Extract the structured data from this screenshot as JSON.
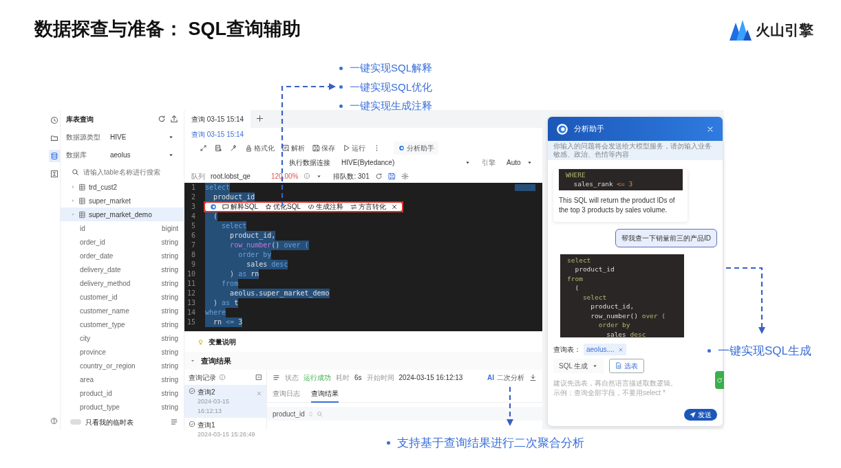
{
  "slide": {
    "title": "数据探查与准备： SQL查询辅助",
    "logo": "火山引擎"
  },
  "callouts": [
    {
      "text": "一键实现SQL解释"
    },
    {
      "text": "一键实现SQL优化"
    },
    {
      "text": "一键实现生成注释"
    }
  ],
  "callout_generate": {
    "text": "一键实现SQL生成"
  },
  "callout_results": {
    "text": "支持基于查询结果进行二次聚合分析"
  },
  "rail": [
    {
      "kind": "history",
      "selected": false
    },
    {
      "kind": "folder",
      "selected": false
    },
    {
      "kind": "database",
      "selected": true
    },
    {
      "kind": "formula",
      "selected": false
    }
  ],
  "sidebar": {
    "title": "库表查询",
    "fields": [
      {
        "label": "数据源类型",
        "value": "HIVE"
      },
      {
        "label": "数据库",
        "value": "aeolus"
      }
    ],
    "search": {
      "placeholder": "请输入table名称进行搜索"
    },
    "tables": [
      {
        "name": "trd_cust2",
        "expanded": false,
        "selected": false
      },
      {
        "name": "super_market",
        "expanded": false,
        "selected": false
      },
      {
        "name": "super_market_demo",
        "expanded": true,
        "selected": true,
        "children": [
          {
            "name": "id",
            "type": "bigint"
          },
          {
            "name": "order_id",
            "type": "string"
          },
          {
            "name": "order_date",
            "type": "string"
          },
          {
            "name": "delivery_date",
            "type": "string"
          },
          {
            "name": "delivery_method",
            "type": "string"
          },
          {
            "name": "customer_id",
            "type": "string"
          },
          {
            "name": "customer_name",
            "type": "string"
          },
          {
            "name": "customer_type",
            "type": "string"
          },
          {
            "name": "city",
            "type": "string"
          },
          {
            "name": "province",
            "type": "string"
          },
          {
            "name": "country_or_region",
            "type": "string"
          },
          {
            "name": "area",
            "type": "string"
          },
          {
            "name": "product_id",
            "type": "string"
          },
          {
            "name": "product_type",
            "type": "string"
          }
        ]
      }
    ],
    "temp_only": {
      "label": "只看我的临时表",
      "on": false
    }
  },
  "editor": {
    "tabs": [
      {
        "label": "查询 03-15 15:14",
        "selected": true
      }
    ],
    "breadcrumb": "查询 03-15 15:14",
    "tools": [
      {
        "kind": "expand"
      },
      {
        "kind": "insert"
      },
      {
        "kind": "wand"
      },
      {
        "kind": "format",
        "label": "格式化"
      },
      {
        "kind": "parse",
        "label": "解析"
      },
      {
        "kind": "save",
        "label": "保存"
      },
      {
        "kind": "run",
        "label": "运行"
      },
      {
        "kind": "more"
      }
    ],
    "assistant_button": "分析助手",
    "connection_label": "执行数据连接",
    "connection": "HIVE(Bytedance)",
    "engine_label": "引擎",
    "engine": "Auto",
    "queue_label": "队列",
    "queue": "root.lobst_qe",
    "usage": "120.00%",
    "queue_count": "排队数: 301",
    "code_selected": true,
    "lines": [
      {
        "n": "1",
        "tokens": [
          {
            "kind": "kw",
            "text": "select"
          }
        ]
      },
      {
        "n": "2",
        "tokens": [
          {
            "kind": "id",
            "text": "  product_id"
          }
        ]
      },
      {
        "n": "3"
      },
      {
        "n": "4",
        "tokens": [
          {
            "kind": "punct",
            "text": "  ("
          }
        ]
      },
      {
        "n": "5",
        "tokens": [
          {
            "kind": "kw",
            "text": "    select"
          }
        ]
      },
      {
        "n": "6",
        "tokens": [
          {
            "kind": "id",
            "text": "      product_id,"
          }
        ]
      },
      {
        "n": "7",
        "tokens": [
          {
            "kind": "fn",
            "text": "      row_number"
          },
          {
            "kind": "punct",
            "text": "() "
          },
          {
            "kind": "kw",
            "text": "over ("
          }
        ]
      },
      {
        "n": "8",
        "tokens": [
          {
            "kind": "kw",
            "text": "        order by"
          }
        ]
      },
      {
        "n": "9",
        "tokens": [
          {
            "kind": "id",
            "text": "          sales "
          },
          {
            "kind": "kw",
            "text": "desc"
          }
        ]
      },
      {
        "n": "10",
        "tokens": [
          {
            "kind": "punct",
            "text": "      ) "
          },
          {
            "kind": "kw",
            "text": "as "
          },
          {
            "kind": "id",
            "text": "rn"
          }
        ]
      },
      {
        "n": "11",
        "tokens": [
          {
            "kind": "kw",
            "text": "    from"
          }
        ]
      },
      {
        "n": "12",
        "tokens": [
          {
            "kind": "id",
            "text": "      aeolus.super_market_demo"
          }
        ]
      },
      {
        "n": "13",
        "tokens": [
          {
            "kind": "punct",
            "text": "  ) "
          },
          {
            "kind": "kw",
            "text": "as "
          },
          {
            "kind": "id",
            "text": "t"
          }
        ]
      },
      {
        "n": "14",
        "tokens": [
          {
            "kind": "kw",
            "text": "where"
          }
        ]
      },
      {
        "n": "15",
        "tokens": [
          {
            "kind": "id",
            "text": "  rn "
          },
          {
            "kind": "op",
            "text": "<= "
          },
          {
            "kind": "num",
            "text": "3"
          }
        ]
      }
    ],
    "ai_toolbar": {
      "highlighted": true,
      "items": [
        {
          "kind": "explain",
          "label": "解释SQL"
        },
        {
          "kind": "optimize",
          "label": "优化SQL"
        },
        {
          "kind": "comment",
          "label": "生成注释"
        },
        {
          "kind": "convert",
          "label": "方言转化"
        }
      ]
    }
  },
  "results": {
    "variables": "变量说明",
    "title": "查询结果",
    "expanded": true,
    "history_title": "查询记录",
    "history": [
      {
        "name": "查询2",
        "time": "2024-03-15 16:12:13",
        "selected": true
      },
      {
        "name": "查询1",
        "time": "2024-03-15 15:26:49",
        "selected": false
      }
    ],
    "status_label": "状态",
    "status": "运行成功",
    "duration_label": "耗时",
    "duration": "6s",
    "start_label": "开始时间",
    "start": "2024-03-15 16:12:13",
    "ai_badge": "AI",
    "ai_action": "二次分析",
    "tabs": [
      {
        "label": "查询日志",
        "selected": false
      },
      {
        "label": "查询结果",
        "selected": true
      }
    ],
    "columns": [
      "product_id"
    ]
  },
  "assistant": {
    "title": "分析助手",
    "notice": "你输入的问题将会发送给大模型服务，请勿输入业务敏感、政治、色情等内容",
    "messages": [
      {
        "kind": "bot",
        "code": [
          [
            {
              "kind": "kw",
              "text": "WHERE"
            }
          ],
          [
            {
              "kind": "id",
              "text": "  sales_rank "
            },
            {
              "kind": "op",
              "text": "<= "
            },
            {
              "kind": "num",
              "text": "3"
            }
          ]
        ],
        "text": "This SQL will return the product IDs of the top 3 products by sales volume."
      },
      {
        "kind": "user",
        "text": "帮我查一下销量前三的产品ID"
      },
      {
        "kind": "code",
        "code": [
          [
            {
              "kind": "kw",
              "text": "select"
            }
          ],
          [
            {
              "kind": "id",
              "text": "  product_id"
            }
          ],
          [
            {
              "kind": "kw",
              "text": "from"
            }
          ],
          [
            {
              "kind": "id",
              "text": "  ("
            }
          ],
          [
            {
              "kind": "kw",
              "text": "    select"
            }
          ],
          [
            {
              "kind": "id",
              "text": "      product_id,"
            }
          ],
          [
            {
              "kind": "id",
              "text": "      row_number() "
            },
            {
              "kind": "kw",
              "text": "over ("
            }
          ],
          [
            {
              "kind": "kw",
              "text": "        order by"
            }
          ],
          [
            {
              "kind": "id",
              "text": "          sales "
            },
            {
              "kind": "kw",
              "text": "desc"
            }
          ]
        ]
      }
    ],
    "table_label": "查询表：",
    "table_chip": "aeolus....",
    "mode": "SQL 生成",
    "pick_table": "选表",
    "placeholder": [
      "建议先选表，再自然语言描述取数逻辑。",
      "示例：查询全部字段，不要用select *"
    ],
    "send": "发送"
  }
}
